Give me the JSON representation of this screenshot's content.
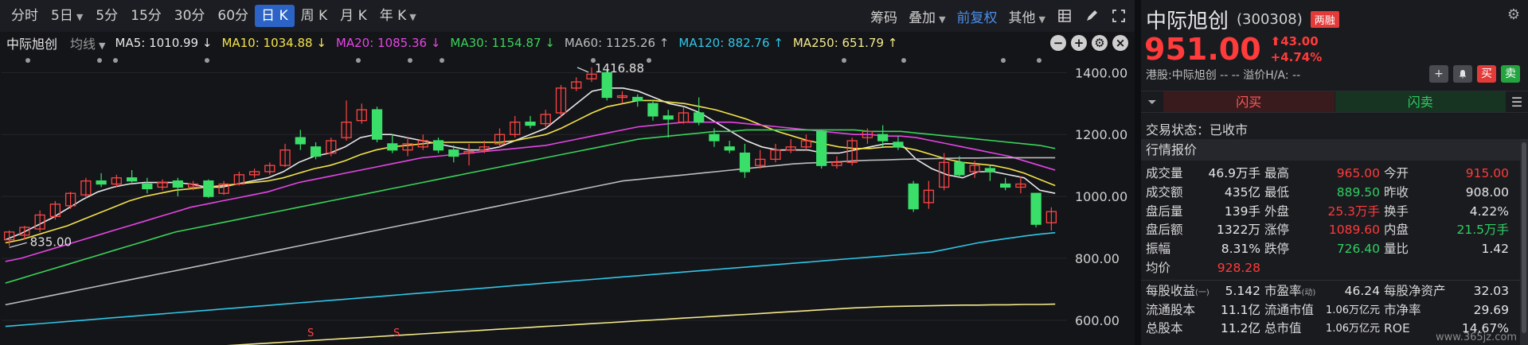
{
  "periods": [
    "分时",
    "5日",
    "5分",
    "15分",
    "30分",
    "60分",
    "日 K",
    "周 K",
    "月 K",
    "年 K"
  ],
  "period_has_caret": [
    false,
    true,
    false,
    false,
    false,
    false,
    false,
    false,
    false,
    true
  ],
  "active_period": "日 K",
  "toolbar": {
    "chip": "筹码",
    "overlay": "叠加",
    "adjust": "前复权",
    "other": "其他"
  },
  "ma_bar": {
    "stock": "中际旭创",
    "avg_label": "均线",
    "items": [
      {
        "text": "MA5: 1010.99 ↓",
        "color": "#e8e8e8"
      },
      {
        "text": "MA10: 1034.88 ↓",
        "color": "#f4e24a"
      },
      {
        "text": "MA20: 1085.36 ↓",
        "color": "#e645e6"
      },
      {
        "text": "MA30: 1154.87 ↓",
        "color": "#3ad35a"
      },
      {
        "text": "MA60: 1125.26 ↑",
        "color": "#bdbdbd"
      },
      {
        "text": "MA120: 882.76 ↑",
        "color": "#2fc7e8"
      },
      {
        "text": "MA250: 651.79 ↑",
        "color": "#f4ea8a"
      }
    ],
    "controls": [
      "−",
      "+",
      "⚙",
      "×"
    ]
  },
  "chart_data": {
    "type": "candlestick",
    "y_ticks": [
      "1400.00",
      "1200.00",
      "1000.00",
      "800.00",
      "600.00"
    ],
    "y_tick_values": [
      1400,
      1200,
      1000,
      800,
      600
    ],
    "ylim": [
      520,
      1460
    ],
    "high_annotation": "1416.88",
    "low_annotation": "835.00",
    "s_markers": [
      "S",
      "S"
    ],
    "candles": [
      {
        "o": 860,
        "c": 885,
        "h": 890,
        "l": 840
      },
      {
        "o": 875,
        "c": 900,
        "h": 905,
        "l": 860
      },
      {
        "o": 895,
        "c": 940,
        "h": 955,
        "l": 885
      },
      {
        "o": 935,
        "c": 975,
        "h": 985,
        "l": 925
      },
      {
        "o": 970,
        "c": 1010,
        "h": 1015,
        "l": 960
      },
      {
        "o": 1005,
        "c": 1050,
        "h": 1060,
        "l": 995
      },
      {
        "o": 1050,
        "c": 1040,
        "h": 1075,
        "l": 1030
      },
      {
        "o": 1040,
        "c": 1060,
        "h": 1070,
        "l": 1030
      },
      {
        "o": 1060,
        "c": 1050,
        "h": 1085,
        "l": 1045
      },
      {
        "o": 1040,
        "c": 1025,
        "h": 1060,
        "l": 1010
      },
      {
        "o": 1030,
        "c": 1045,
        "h": 1055,
        "l": 1020
      },
      {
        "o": 1050,
        "c": 1030,
        "h": 1060,
        "l": 1000
      },
      {
        "o": 1030,
        "c": 1040,
        "h": 1050,
        "l": 1020
      },
      {
        "o": 1050,
        "c": 1000,
        "h": 1055,
        "l": 995
      },
      {
        "o": 1010,
        "c": 1040,
        "h": 1050,
        "l": 1005
      },
      {
        "o": 1040,
        "c": 1070,
        "h": 1080,
        "l": 1035
      },
      {
        "o": 1070,
        "c": 1080,
        "h": 1090,
        "l": 1060
      },
      {
        "o": 1080,
        "c": 1100,
        "h": 1110,
        "l": 1070
      },
      {
        "o": 1100,
        "c": 1150,
        "h": 1170,
        "l": 1095
      },
      {
        "o": 1190,
        "c": 1170,
        "h": 1215,
        "l": 1150
      },
      {
        "o": 1160,
        "c": 1130,
        "h": 1175,
        "l": 1120
      },
      {
        "o": 1140,
        "c": 1180,
        "h": 1190,
        "l": 1130
      },
      {
        "o": 1190,
        "c": 1240,
        "h": 1310,
        "l": 1180
      },
      {
        "o": 1245,
        "c": 1280,
        "h": 1300,
        "l": 1235
      },
      {
        "o": 1280,
        "c": 1185,
        "h": 1290,
        "l": 1175
      },
      {
        "o": 1170,
        "c": 1150,
        "h": 1200,
        "l": 1140
      },
      {
        "o": 1150,
        "c": 1170,
        "h": 1190,
        "l": 1130
      },
      {
        "o": 1160,
        "c": 1180,
        "h": 1200,
        "l": 1150
      },
      {
        "o": 1180,
        "c": 1150,
        "h": 1190,
        "l": 1140
      },
      {
        "o": 1150,
        "c": 1130,
        "h": 1165,
        "l": 1110
      },
      {
        "o": 1140,
        "c": 1145,
        "h": 1170,
        "l": 1100
      },
      {
        "o": 1150,
        "c": 1160,
        "h": 1180,
        "l": 1140
      },
      {
        "o": 1170,
        "c": 1200,
        "h": 1220,
        "l": 1160
      },
      {
        "o": 1200,
        "c": 1240,
        "h": 1260,
        "l": 1190
      },
      {
        "o": 1240,
        "c": 1230,
        "h": 1260,
        "l": 1220
      },
      {
        "o": 1235,
        "c": 1265,
        "h": 1280,
        "l": 1225
      },
      {
        "o": 1270,
        "c": 1350,
        "h": 1360,
        "l": 1255
      },
      {
        "o": 1350,
        "c": 1370,
        "h": 1385,
        "l": 1340
      },
      {
        "o": 1380,
        "c": 1395,
        "h": 1416.88,
        "l": 1370
      },
      {
        "o": 1400,
        "c": 1320,
        "h": 1410,
        "l": 1310
      },
      {
        "o": 1320,
        "c": 1325,
        "h": 1340,
        "l": 1300
      },
      {
        "o": 1320,
        "c": 1310,
        "h": 1330,
        "l": 1290
      },
      {
        "o": 1300,
        "c": 1260,
        "h": 1310,
        "l": 1245
      },
      {
        "o": 1260,
        "c": 1250,
        "h": 1280,
        "l": 1190
      },
      {
        "o": 1240,
        "c": 1270,
        "h": 1290,
        "l": 1235
      },
      {
        "o": 1270,
        "c": 1240,
        "h": 1320,
        "l": 1230
      },
      {
        "o": 1200,
        "c": 1180,
        "h": 1220,
        "l": 1160
      },
      {
        "o": 1160,
        "c": 1150,
        "h": 1180,
        "l": 1140
      },
      {
        "o": 1140,
        "c": 1080,
        "h": 1170,
        "l": 1060
      },
      {
        "o": 1100,
        "c": 1120,
        "h": 1150,
        "l": 1090
      },
      {
        "o": 1120,
        "c": 1150,
        "h": 1170,
        "l": 1110
      },
      {
        "o": 1150,
        "c": 1160,
        "h": 1185,
        "l": 1140
      },
      {
        "o": 1160,
        "c": 1180,
        "h": 1200,
        "l": 1150
      },
      {
        "o": 1210,
        "c": 1100,
        "h": 1215,
        "l": 1090
      },
      {
        "o": 1100,
        "c": 1110,
        "h": 1130,
        "l": 1090
      },
      {
        "o": 1110,
        "c": 1180,
        "h": 1190,
        "l": 1100
      },
      {
        "o": 1190,
        "c": 1210,
        "h": 1220,
        "l": 1170
      },
      {
        "o": 1200,
        "c": 1180,
        "h": 1230,
        "l": 1160
      },
      {
        "o": 1175,
        "c": 1160,
        "h": 1195,
        "l": 1150
      },
      {
        "o": 1040,
        "c": 960,
        "h": 1050,
        "l": 950
      },
      {
        "o": 980,
        "c": 1020,
        "h": 1050,
        "l": 960
      },
      {
        "o": 1030,
        "c": 1110,
        "h": 1140,
        "l": 1020
      },
      {
        "o": 1110,
        "c": 1070,
        "h": 1130,
        "l": 1060
      },
      {
        "o": 1080,
        "c": 1100,
        "h": 1115,
        "l": 1060
      },
      {
        "o": 1090,
        "c": 1080,
        "h": 1100,
        "l": 1050
      },
      {
        "o": 1040,
        "c": 1030,
        "h": 1060,
        "l": 1020
      },
      {
        "o": 1030,
        "c": 1040,
        "h": 1065,
        "l": 1010
      },
      {
        "o": 1010,
        "c": 910,
        "h": 1010,
        "l": 900
      },
      {
        "o": 915,
        "c": 951,
        "h": 965,
        "l": 889.5
      }
    ],
    "ma_lines": [
      {
        "name": "MA5",
        "color": "#e8e8e8",
        "values": [
          860,
          880,
          905,
          930,
          960,
          990,
          1015,
          1030,
          1040,
          1045,
          1045,
          1045,
          1040,
          1030,
          1030,
          1040,
          1050,
          1060,
          1080,
          1110,
          1130,
          1140,
          1160,
          1190,
          1200,
          1200,
          1190,
          1180,
          1170,
          1160,
          1150,
          1150,
          1160,
          1180,
          1200,
          1220,
          1260,
          1300,
          1340,
          1350,
          1350,
          1340,
          1320,
          1300,
          1290,
          1270,
          1240,
          1210,
          1180,
          1160,
          1150,
          1150,
          1150,
          1140,
          1140,
          1150,
          1160,
          1170,
          1170,
          1120,
          1090,
          1070,
          1060,
          1080,
          1080,
          1070,
          1060,
          1020,
          1010
        ]
      },
      {
        "name": "MA10",
        "color": "#f4e24a",
        "values": [
          850,
          860,
          875,
          890,
          905,
          925,
          945,
          965,
          985,
          1000,
          1010,
          1020,
          1025,
          1030,
          1035,
          1040,
          1045,
          1050,
          1060,
          1075,
          1090,
          1100,
          1115,
          1135,
          1150,
          1160,
          1165,
          1170,
          1175,
          1175,
          1175,
          1175,
          1175,
          1180,
          1190,
          1200,
          1220,
          1245,
          1270,
          1290,
          1300,
          1310,
          1310,
          1305,
          1300,
          1290,
          1280,
          1265,
          1250,
          1230,
          1210,
          1195,
          1180,
          1170,
          1160,
          1155,
          1155,
          1160,
          1160,
          1150,
          1135,
          1120,
          1110,
          1105,
          1100,
          1090,
          1075,
          1055,
          1035
        ]
      },
      {
        "name": "MA20",
        "color": "#e645e6",
        "values": [
          790,
          800,
          815,
          830,
          845,
          860,
          875,
          890,
          905,
          920,
          935,
          950,
          965,
          975,
          985,
          995,
          1005,
          1015,
          1030,
          1045,
          1055,
          1065,
          1075,
          1085,
          1095,
          1105,
          1115,
          1125,
          1130,
          1135,
          1140,
          1145,
          1150,
          1155,
          1160,
          1165,
          1175,
          1185,
          1195,
          1205,
          1215,
          1225,
          1230,
          1235,
          1240,
          1240,
          1240,
          1240,
          1235,
          1230,
          1225,
          1220,
          1215,
          1210,
          1205,
          1200,
          1200,
          1195,
          1195,
          1190,
          1180,
          1170,
          1160,
          1150,
          1140,
          1130,
          1115,
          1100,
          1085
        ]
      },
      {
        "name": "MA30",
        "color": "#3ad35a",
        "values": [
          720,
          735,
          750,
          765,
          780,
          795,
          810,
          825,
          840,
          855,
          870,
          885,
          895,
          905,
          915,
          925,
          935,
          945,
          955,
          965,
          975,
          985,
          995,
          1005,
          1015,
          1025,
          1035,
          1045,
          1055,
          1065,
          1075,
          1085,
          1095,
          1105,
          1115,
          1125,
          1135,
          1145,
          1155,
          1165,
          1175,
          1185,
          1190,
          1195,
          1200,
          1205,
          1210,
          1210,
          1215,
          1215,
          1215,
          1215,
          1215,
          1215,
          1215,
          1215,
          1210,
          1210,
          1210,
          1205,
          1200,
          1195,
          1190,
          1185,
          1180,
          1175,
          1170,
          1165,
          1155
        ]
      },
      {
        "name": "MA60",
        "color": "#bdbdbd",
        "values": [
          650,
          660,
          670,
          680,
          690,
          700,
          710,
          720,
          730,
          740,
          750,
          760,
          770,
          780,
          790,
          800,
          810,
          820,
          830,
          840,
          850,
          860,
          870,
          880,
          890,
          900,
          910,
          920,
          930,
          940,
          950,
          960,
          970,
          980,
          990,
          1000,
          1010,
          1020,
          1030,
          1040,
          1050,
          1055,
          1060,
          1065,
          1070,
          1075,
          1080,
          1085,
          1090,
          1095,
          1100,
          1105,
          1108,
          1110,
          1112,
          1115,
          1117,
          1118,
          1120,
          1121,
          1122,
          1123,
          1124,
          1124,
          1125,
          1125,
          1125,
          1125,
          1125
        ]
      },
      {
        "name": "MA120",
        "color": "#2fc7e8",
        "values": [
          580,
          584,
          588,
          592,
          596,
          600,
          604,
          608,
          612,
          616,
          620,
          624,
          628,
          632,
          636,
          640,
          644,
          648,
          652,
          656,
          660,
          664,
          668,
          672,
          676,
          680,
          684,
          688,
          692,
          696,
          700,
          704,
          708,
          712,
          716,
          720,
          724,
          728,
          732,
          736,
          740,
          744,
          748,
          752,
          756,
          760,
          764,
          768,
          772,
          776,
          780,
          784,
          788,
          792,
          796,
          800,
          804,
          808,
          812,
          816,
          820,
          830,
          840,
          850,
          858,
          865,
          872,
          878,
          883
        ]
      },
      {
        "name": "MA250",
        "color": "#f4ea8a",
        "values": [
          475,
          478,
          481,
          484,
          487,
          490,
          493,
          496,
          499,
          502,
          505,
          508,
          511,
          514,
          517,
          520,
          523,
          526,
          529,
          532,
          535,
          538,
          541,
          544,
          547,
          550,
          553,
          556,
          559,
          562,
          565,
          568,
          571,
          574,
          577,
          580,
          583,
          586,
          589,
          592,
          595,
          598,
          601,
          604,
          607,
          610,
          613,
          616,
          619,
          622,
          625,
          628,
          631,
          634,
          637,
          640,
          642,
          644,
          645,
          646,
          647,
          648,
          649,
          649,
          650,
          650,
          651,
          651,
          652
        ]
      }
    ]
  },
  "quote": {
    "name": "中际旭创",
    "code": "(300308)",
    "badge": "两融",
    "price": "951.00",
    "change": "43.00",
    "change_pct": "+4.74%",
    "hk_line": "港股:中际旭创  --   -- 溢价H/A: --",
    "action_buttons": [
      "+",
      "🔔",
      "买",
      "卖"
    ],
    "flash_buy": "闪买",
    "flash_sell": "闪卖",
    "trade_status": "交易状态：已收市",
    "section_title": "行情报价",
    "rows": [
      [
        {
          "l": "成交量",
          "v": "46.9万手",
          "c": ""
        },
        {
          "l": "最高",
          "v": "965.00",
          "c": "red"
        },
        {
          "l": "今开",
          "v": "915.00",
          "c": "red"
        }
      ],
      [
        {
          "l": "成交额",
          "v": "435亿",
          "c": ""
        },
        {
          "l": "最低",
          "v": "889.50",
          "c": "green"
        },
        {
          "l": "昨收",
          "v": "908.00",
          "c": ""
        }
      ],
      [
        {
          "l": "盘后量",
          "v": "139手",
          "c": ""
        },
        {
          "l": "外盘",
          "v": "25.3万手",
          "c": "red"
        },
        {
          "l": "换手",
          "v": "4.22%",
          "c": ""
        }
      ],
      [
        {
          "l": "盘后额",
          "v": "1322万",
          "c": ""
        },
        {
          "l": "涨停",
          "v": "1089.60",
          "c": "red"
        },
        {
          "l": "内盘",
          "v": "21.5万手",
          "c": "green"
        }
      ],
      [
        {
          "l": "振幅",
          "v": "8.31%",
          "c": ""
        },
        {
          "l": "跌停",
          "v": "726.40",
          "c": "green"
        },
        {
          "l": "量比",
          "v": "1.42",
          "c": ""
        }
      ],
      [
        {
          "l": "均价",
          "v": "928.28",
          "c": "red"
        }
      ]
    ],
    "rows2": [
      [
        {
          "l": "每股收益",
          "sub": "(一)",
          "v": "5.142"
        },
        {
          "l": "市盈率",
          "sub": "(动)",
          "v": "46.24"
        },
        {
          "l": "每股净资产",
          "sub": "",
          "v": "32.03"
        }
      ],
      [
        {
          "l": "流通股本",
          "sub": "",
          "v": "11.1亿"
        },
        {
          "l": "流通市值",
          "sub": "",
          "v": "1.06万亿元"
        },
        {
          "l": "市净率",
          "sub": "",
          "v": "29.69"
        }
      ],
      [
        {
          "l": "总股本",
          "sub": "",
          "v": "11.2亿"
        },
        {
          "l": "总市值",
          "sub": "",
          "v": "1.06万亿元"
        },
        {
          "l": "ROE",
          "sub": "",
          "v": "14.67%"
        }
      ]
    ],
    "watermark": "www.365jz.com"
  }
}
